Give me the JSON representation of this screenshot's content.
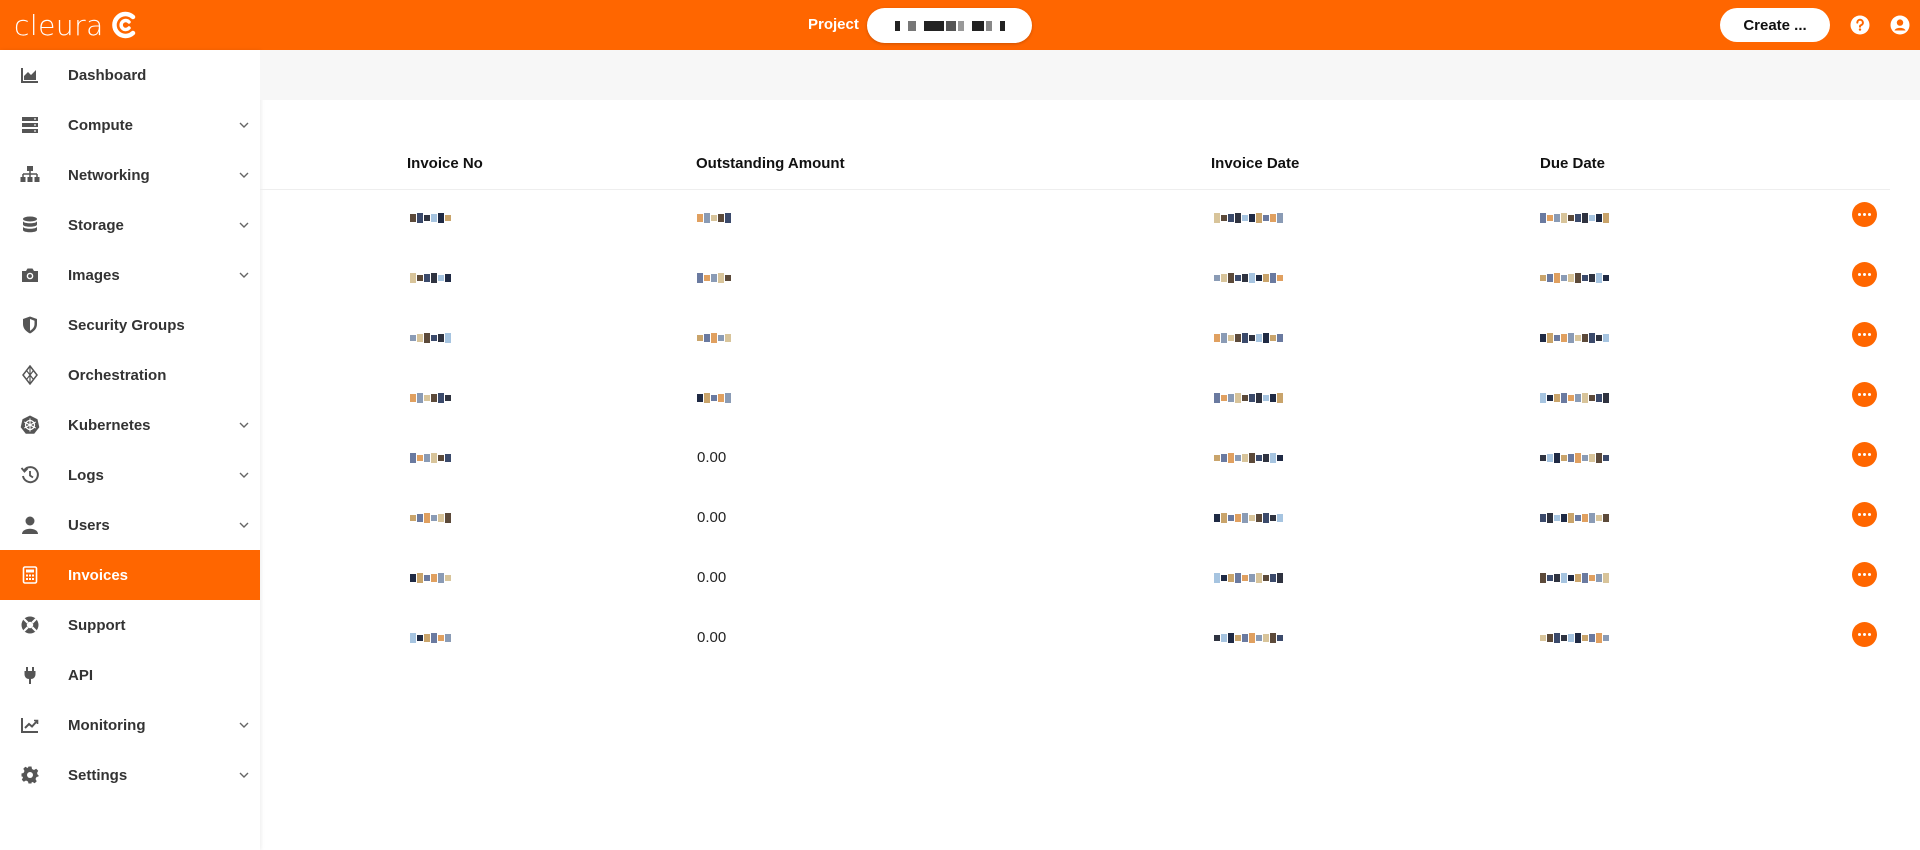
{
  "app": {
    "logo_text": "cleura",
    "project_label": "Project",
    "create_label": "Create ..."
  },
  "colors": {
    "brand": "#ff6600",
    "sidebar_text": "#333333",
    "icon_gray": "#555555"
  },
  "sidebar": {
    "items": [
      {
        "label": "Dashboard",
        "icon": "dashboard-chart-icon",
        "has_chevron": false,
        "active": false
      },
      {
        "label": "Compute",
        "icon": "server-icon",
        "has_chevron": true,
        "active": false
      },
      {
        "label": "Networking",
        "icon": "network-icon",
        "has_chevron": true,
        "active": false
      },
      {
        "label": "Storage",
        "icon": "database-icon",
        "has_chevron": true,
        "active": false
      },
      {
        "label": "Images",
        "icon": "camera-icon",
        "has_chevron": true,
        "active": false
      },
      {
        "label": "Security Groups",
        "icon": "shield-icon",
        "has_chevron": false,
        "active": false
      },
      {
        "label": "Orchestration",
        "icon": "orchestration-icon",
        "has_chevron": false,
        "active": false
      },
      {
        "label": "Kubernetes",
        "icon": "kubernetes-icon",
        "has_chevron": true,
        "active": false
      },
      {
        "label": "Logs",
        "icon": "history-icon",
        "has_chevron": true,
        "active": false
      },
      {
        "label": "Users",
        "icon": "user-icon",
        "has_chevron": true,
        "active": false
      },
      {
        "label": "Invoices",
        "icon": "calculator-icon",
        "has_chevron": false,
        "active": true
      },
      {
        "label": "Support",
        "icon": "lifebuoy-icon",
        "has_chevron": false,
        "active": false
      },
      {
        "label": "API",
        "icon": "plug-icon",
        "has_chevron": false,
        "active": false
      },
      {
        "label": "Monitoring",
        "icon": "trend-chart-icon",
        "has_chevron": true,
        "active": false
      },
      {
        "label": "Settings",
        "icon": "gear-icon",
        "has_chevron": true,
        "active": false
      }
    ]
  },
  "invoices": {
    "columns": [
      "Invoice No",
      "Outstanding Amount",
      "Invoice Date",
      "Due Date"
    ],
    "rows": [
      {
        "outstanding": ""
      },
      {
        "outstanding": ""
      },
      {
        "outstanding": ""
      },
      {
        "outstanding": ""
      },
      {
        "outstanding": "0.00"
      },
      {
        "outstanding": "0.00"
      },
      {
        "outstanding": "0.00"
      },
      {
        "outstanding": "0.00"
      }
    ]
  }
}
